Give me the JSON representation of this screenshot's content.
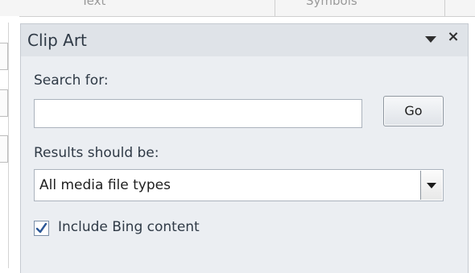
{
  "ribbon": {
    "tabs": [
      {
        "label": "Text"
      },
      {
        "label": "Symbols"
      }
    ]
  },
  "pane": {
    "title": "Clip Art",
    "menu_icon": "chevron-down-icon",
    "close_icon": "close-icon",
    "close_glyph": "×",
    "search_label": "Search for:",
    "search": {
      "value": "",
      "placeholder": ""
    },
    "go_label": "Go",
    "results_label": "Results should be:",
    "results_select": {
      "selected": "All media file types",
      "options": [
        "All media file types"
      ]
    },
    "include_bing": {
      "label": "Include Bing content",
      "checked": true
    }
  },
  "colors": {
    "pane_bg": "#ebeef2",
    "header_bg": "#dfe3e8",
    "text": "#2f3a46",
    "border": "#abb3bd",
    "check": "#2b5797"
  }
}
